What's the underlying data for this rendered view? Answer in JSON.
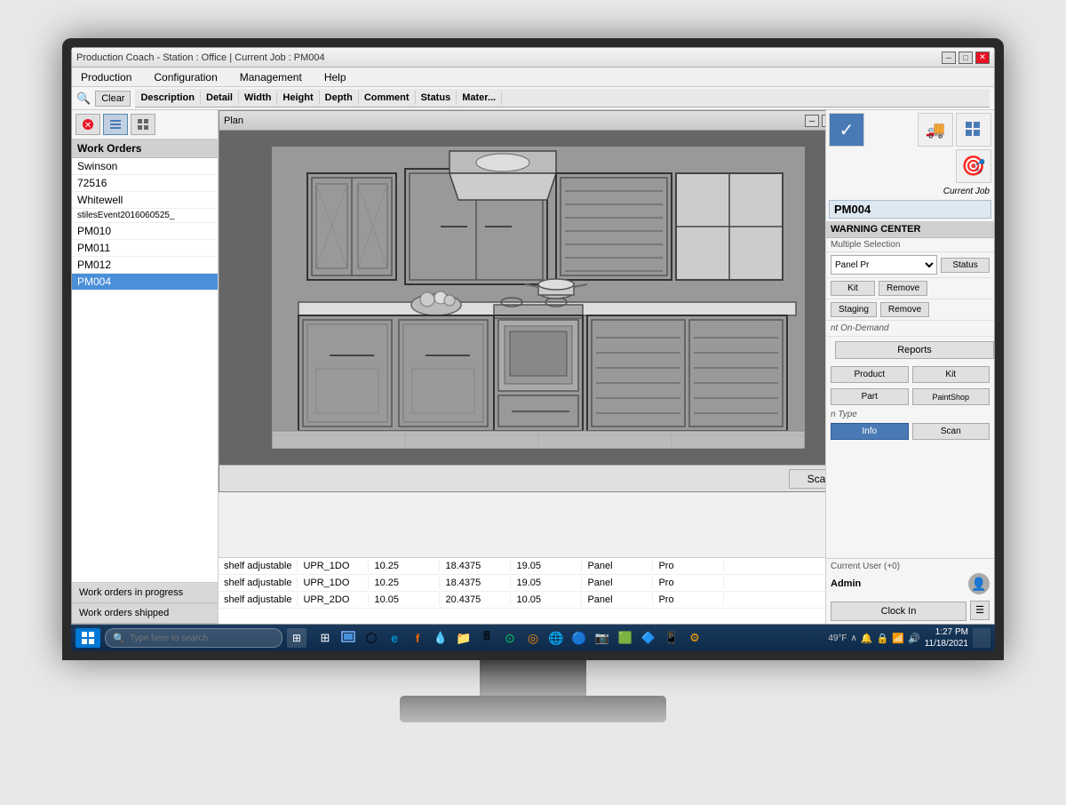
{
  "window": {
    "title": "Production Coach - Station : Office | Current Job : PM004",
    "plan_title": "Plan"
  },
  "menu": {
    "items": [
      "Production",
      "Configuration",
      "Management",
      "Help"
    ]
  },
  "toolbar": {
    "clear_label": "Clear",
    "columns": [
      "Description",
      "Detail",
      "Width",
      "Height",
      "Depth",
      "Comment",
      "Status",
      "Mater..."
    ]
  },
  "sidebar": {
    "work_orders_header": "Work Orders",
    "items": [
      {
        "label": "Swinson",
        "selected": false
      },
      {
        "label": "72516",
        "selected": false
      },
      {
        "label": "Whitewell",
        "selected": false
      },
      {
        "label": "stilesEvent2016060525_",
        "selected": false
      },
      {
        "label": "PM010",
        "selected": false
      },
      {
        "label": "PM011",
        "selected": false
      },
      {
        "label": "PM012",
        "selected": false
      },
      {
        "label": "PM004",
        "selected": true
      }
    ],
    "bottom_btns": [
      "Work orders in progress",
      "Work orders shipped"
    ]
  },
  "right_panel": {
    "current_job_label": "Current Job",
    "job_number": "PM004",
    "warning_center": "WARNING CENTER",
    "multiple_selection": "Multiple Selection",
    "panel_pr_placeholder": "Panel Pr",
    "status_btn": "Status",
    "kit_btn": "Kit",
    "remove_btn1": "Remove",
    "staging_btn": "Staging",
    "remove_btn2": "Remove",
    "print_on_demand": "nt On-Demand",
    "reports_btn": "Reports",
    "product_btn": "Product",
    "kit_btn2": "Kit",
    "part_btn": "Part",
    "paintshop_btn": "PaintShop",
    "run_type": "n Type",
    "info_btn": "Info",
    "scan_btn": "Scan",
    "current_user": "Current User (+0)",
    "admin": "Admin",
    "clock_in_btn": "Clock In"
  },
  "table": {
    "rows": [
      {
        "desc": "shelf adjustable",
        "detail": "UPR_1DO",
        "width": "10.25",
        "height": "18.4375",
        "depth": "19.05",
        "status": "Panel",
        "material": "Pro"
      },
      {
        "desc": "shelf adjustable",
        "detail": "UPR_1DO",
        "width": "10.25",
        "height": "18.4375",
        "depth": "19.05",
        "status": "Panel",
        "material": "Pro"
      },
      {
        "desc": "shelf adjustable",
        "detail": "UPR_2DO",
        "width": "10.05",
        "height": "20.4375",
        "depth": "10.05",
        "status": "Panel",
        "material": "Pro"
      }
    ]
  },
  "scan_btn_label": "Scan",
  "taskbar": {
    "search_placeholder": "Type here to search",
    "time": "1:27 PM",
    "date": "11/18/2021",
    "temperature": "49°F"
  }
}
